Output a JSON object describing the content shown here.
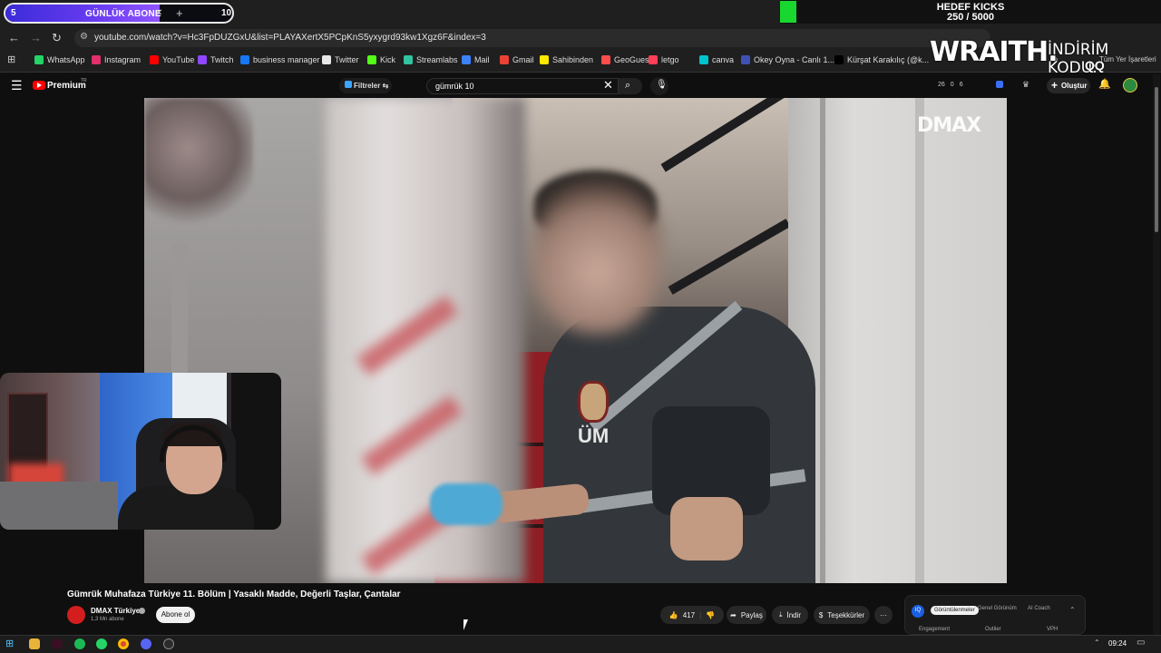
{
  "stream_overlay": {
    "daily_sub_label": "GÜNLÜK ABONE",
    "daily_sub_current": "5",
    "daily_sub_target": "10",
    "goal_title": "HEDEF KICKS",
    "goal_progress": "250 / 5000",
    "sponsor_logo": "WRAITH.",
    "promo_label": "İNDİRİM KODU:",
    "promo_code": "QQ"
  },
  "browser": {
    "url": "youtube.com/watch?v=Hc3FpDUZGxU&list=PLAYAXertX5PCpKnS5yxygrd93kw1Xgz6F&index=3",
    "bookmarks": [
      {
        "label": "WhatsApp",
        "color": "#25d366"
      },
      {
        "label": "Instagram",
        "color": "#e1306c"
      },
      {
        "label": "YouTube",
        "color": "#ff0000"
      },
      {
        "label": "Twitch",
        "color": "#9146ff"
      },
      {
        "label": "business manager",
        "color": "#1877f2"
      },
      {
        "label": "Twitter",
        "color": "#e7e7e7"
      },
      {
        "label": "Kick",
        "color": "#53fc18"
      },
      {
        "label": "Streamlabs",
        "color": "#31c3a2"
      },
      {
        "label": "Mail",
        "color": "#3b82f6"
      },
      {
        "label": "Gmail",
        "color": "#ea4335"
      },
      {
        "label": "Sahibinden",
        "color": "#ffe800"
      },
      {
        "label": "GeoGuessr",
        "color": "#ff4d4d"
      },
      {
        "label": "letgo",
        "color": "#ff3f55"
      },
      {
        "label": "canva",
        "color": "#00c4cc"
      },
      {
        "label": "Okey Oyna - Canlı 1...",
        "color": "#3f51b5"
      },
      {
        "label": "Kürşat Karakılıç (@k...",
        "color": "#000000"
      }
    ],
    "bookmarks_more": "»",
    "bookmarks_other": "Tüm Yer İşaretleri"
  },
  "youtube": {
    "logo_label": "Premium",
    "region": "TR",
    "filters_label": "Filtreler",
    "search_value": "gümrük 10",
    "ext_stats": [
      "26",
      "0",
      "6"
    ],
    "create_label": "Oluştur",
    "video_watermark": "DMAX",
    "video_title": "Gümrük Muhafaza Türkiye 11. Bölüm | Yasaklı Madde, Değerli Taşlar, Çantalar",
    "channel_name": "DMAX Türkiye",
    "channel_subs": "1,3 Mn abone",
    "subscribe_label": "Abone ol",
    "likes": "417",
    "share_label": "Paylaş",
    "download_label": "İndir",
    "thanks_label": "Teşekkürler",
    "more_label": "···",
    "badge_text": "ÜM"
  },
  "ext_panel": {
    "logo": "IQ",
    "tabs": [
      "Görüntülenmeler",
      "Genel Görünüm",
      "AI Coach"
    ],
    "columns": [
      "Engagement",
      "Outlier",
      "VPH"
    ]
  },
  "taskbar": {
    "time": "09:24"
  }
}
